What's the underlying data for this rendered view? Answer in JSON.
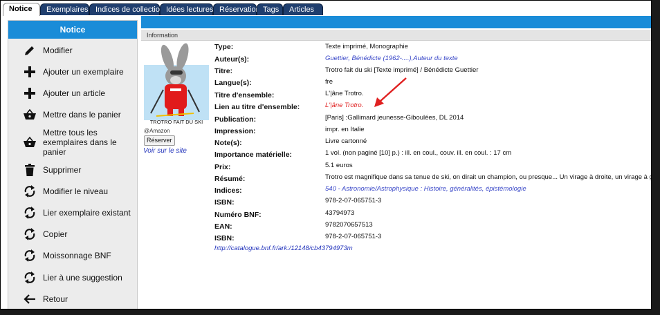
{
  "tabs": [
    "Notice",
    "Exemplaires",
    "Indices de collection",
    "Idées lectures",
    "Réservations",
    "Tags",
    "Articles"
  ],
  "sidebar": {
    "title": "Notice",
    "items": [
      {
        "label": "Modifier",
        "icon": "pencil-icon"
      },
      {
        "label": "Ajouter un exemplaire",
        "icon": "plus-icon"
      },
      {
        "label": "Ajouter un article",
        "icon": "plus-icon"
      },
      {
        "label": "Mettre dans le panier",
        "icon": "basket-icon"
      },
      {
        "label": "Mettre tous les exemplaires dans le panier",
        "icon": "basket-icon"
      },
      {
        "label": "Supprimer",
        "icon": "trash-icon"
      },
      {
        "label": "Modifier le niveau",
        "icon": "refresh-icon"
      },
      {
        "label": "Lier exemplaire existant",
        "icon": "refresh-icon"
      },
      {
        "label": "Copier",
        "icon": "refresh-icon"
      },
      {
        "label": "Moissonnage BNF",
        "icon": "refresh-icon"
      },
      {
        "label": "Lier à une suggestion",
        "icon": "refresh-icon"
      },
      {
        "label": "Retour",
        "icon": "arrow-left-icon"
      }
    ]
  },
  "info_label": "Information",
  "cover": {
    "caption": "TROTRO FAIT DU SKI",
    "source": "@Amazon",
    "reserve_label": "Réserver",
    "site_link": "Voir sur le site"
  },
  "record": [
    {
      "label": "Type:",
      "value": "Texte imprimé, Monographie",
      "style": "plain"
    },
    {
      "label": "Auteur(s):",
      "value": "Guettier, Bénédicte (1962-....),Auteur du texte",
      "style": "link"
    },
    {
      "label": "Titre:",
      "value": "Trotro fait du ski [Texte imprimé] / Bénédicte Guettier",
      "style": "plain"
    },
    {
      "label": "Langue(s):",
      "value": "fre",
      "style": "plain"
    },
    {
      "label": "Titre d'ensemble:",
      "value": "L'|âne Trotro.",
      "style": "plain"
    },
    {
      "label": "Lien au titre d'ensemble:",
      "value": "L'|âne Trotro.",
      "style": "red"
    },
    {
      "label": "Publication:",
      "value": "[Paris] :Gallimard jeunesse-Giboulées, DL 2014",
      "style": "plain"
    },
    {
      "label": "Impression:",
      "value": "impr. en Italie",
      "style": "plain"
    },
    {
      "label": "Note(s):",
      "value": "Livre cartonné",
      "style": "plain"
    },
    {
      "label": "Importance matérielle:",
      "value": "1 vol. (non paginé [10] p.) : ill. en coul., couv. ill. en coul. : 17 cm",
      "style": "plain"
    },
    {
      "label": "Prix:",
      "value": "5.1 euros",
      "style": "plain"
    },
    {
      "label": "Résumé:",
      "value": "Trotro est magnifique dans sa tenue de ski, on dirait un champion, ou presque... Un virage à droite, un virage à gauche",
      "style": "plain"
    },
    {
      "label": "Indices:",
      "value": "540 - Astronomie/Astrophysique : Histoire, généralités, épistémologie",
      "style": "link"
    },
    {
      "label": "ISBN:",
      "value": "978-2-07-065751-3",
      "style": "plain"
    },
    {
      "label": "Numéro BNF:",
      "value": "43794973",
      "style": "plain"
    },
    {
      "label": "EAN:",
      "value": "9782070657513",
      "style": "plain"
    },
    {
      "label": "ISBN:",
      "value": "978-2-07-065751-3",
      "style": "plain"
    }
  ],
  "ark_link": "http://catalogue.bnf.fr/ark:/12148/cb43794973m",
  "colors": {
    "accent": "#1a8cd8",
    "tab_dark": "#1f3e6e",
    "link": "#3a48c8",
    "annotation_red": "#e02020"
  }
}
